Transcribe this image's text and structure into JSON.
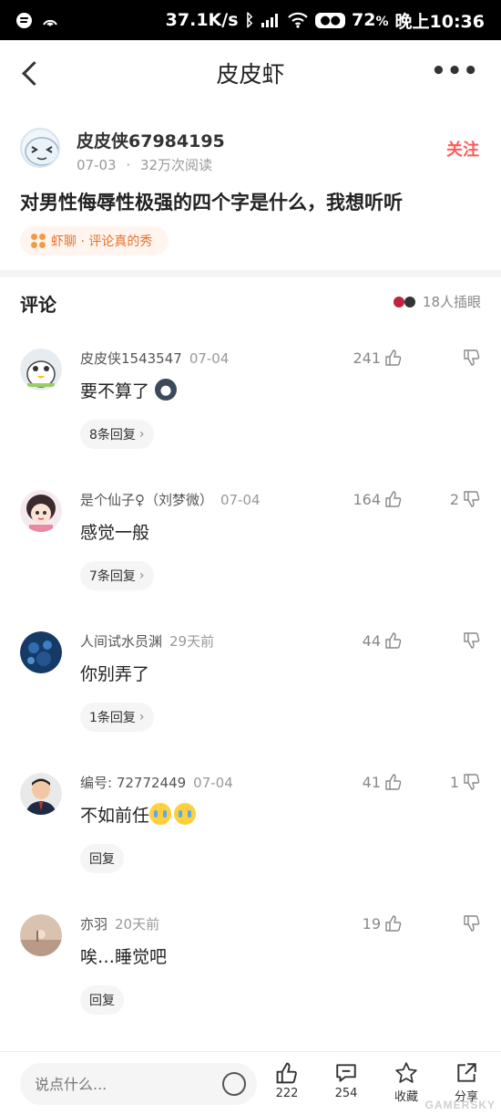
{
  "status_bar": {
    "network_speed": "37.1K/s",
    "battery": "72",
    "battery_suffix": "%",
    "time": "晚上10:36"
  },
  "nav": {
    "title": "皮皮虾"
  },
  "post": {
    "author": "皮皮侠67984195",
    "date": "07-03",
    "separator": "·",
    "reads": "32万次阅读",
    "follow_label": "关注",
    "title": "对男性侮辱性极强的四个字是什么，我想听听",
    "topic": "虾聊 · 评论真的秀"
  },
  "comments_header": {
    "title": "评论",
    "viewers": "18人插眼"
  },
  "comments": [
    {
      "name": "皮皮侠1543547",
      "time": "07-04",
      "text": "要不算了",
      "emoji": "cat",
      "replies": "8条回复",
      "likes": "241",
      "dislikes": ""
    },
    {
      "name": "是个仙子♀（刘梦微）",
      "time": "07-04",
      "text": "感觉一般",
      "emoji": "",
      "replies": "7条回复",
      "likes": "164",
      "dislikes": "2"
    },
    {
      "name": "人间试水员渊",
      "time": "29天前",
      "text": "你别弄了",
      "emoji": "",
      "replies": "1条回复",
      "likes": "44",
      "dislikes": ""
    },
    {
      "name": "编号: 72772449",
      "time": "07-04",
      "text": "不如前任",
      "emoji": "cry",
      "replies": "回复",
      "likes": "41",
      "dislikes": "1"
    },
    {
      "name": "亦羽",
      "time": "20天前",
      "text": "唉…睡觉吧",
      "emoji": "",
      "replies": "回复",
      "likes": "19",
      "dislikes": ""
    }
  ],
  "bottom_bar": {
    "input_placeholder": "说点什么...",
    "like_count": "222",
    "comment_count": "254",
    "favorite_label": "收藏",
    "share_label": "分享"
  },
  "watermark": "GAMERSKY"
}
